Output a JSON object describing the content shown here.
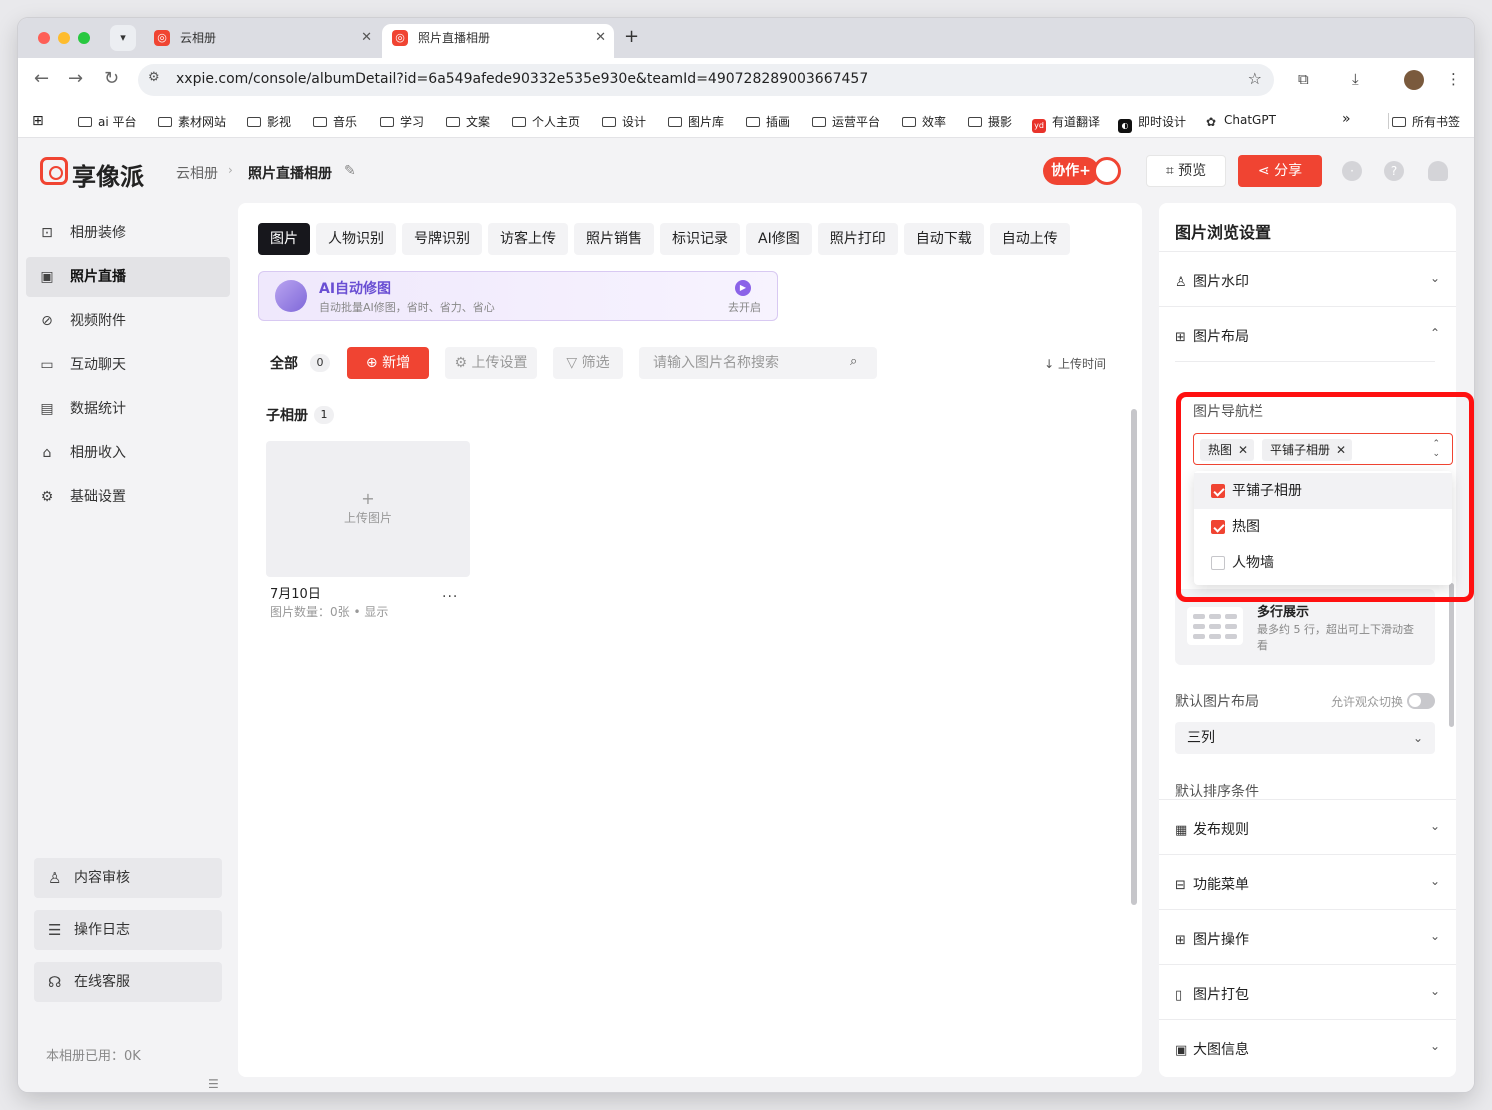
{
  "browser": {
    "tabs": [
      {
        "title": "云相册"
      },
      {
        "title": "照片直播相册"
      }
    ],
    "url": "xxpie.com/console/albumDetail?id=6a549afede90332e535e930e&teamId=490728289003667457",
    "bookmarks": [
      "ai 平台",
      "素材网站",
      "影视",
      "音乐",
      "学习",
      "文案",
      "个人主页",
      "设计",
      "图片库",
      "插画",
      "运营平台",
      "效率",
      "摄影",
      "有道翻译",
      "即时设计",
      "ChatGPT"
    ],
    "more_bookmarks": "»",
    "all_bookmarks": "所有书签"
  },
  "header": {
    "logo_text": "享像派",
    "breadcrumb": [
      "云相册",
      "照片直播相册"
    ],
    "collab_label": "协作+",
    "preview_label": "预览",
    "share_label": "分享"
  },
  "sidebar": {
    "items": [
      {
        "label": "相册装修",
        "icon": "frame-icon"
      },
      {
        "label": "照片直播",
        "icon": "image-icon",
        "active": true
      },
      {
        "label": "视频附件",
        "icon": "paperclip-icon"
      },
      {
        "label": "互动聊天",
        "icon": "chat-icon"
      },
      {
        "label": "数据统计",
        "icon": "chart-icon"
      },
      {
        "label": "相册收入",
        "icon": "store-icon"
      },
      {
        "label": "基础设置",
        "icon": "gear-icon"
      }
    ],
    "bottom_buttons": [
      {
        "label": "内容审核",
        "icon": "audit-icon"
      },
      {
        "label": "操作日志",
        "icon": "log-icon"
      },
      {
        "label": "在线客服",
        "icon": "headset-icon"
      }
    ],
    "usage": "本相册已用：0K"
  },
  "main": {
    "tabs": [
      "图片",
      "人物识别",
      "号牌识别",
      "访客上传",
      "照片销售",
      "标识记录",
      "AI修图",
      "照片打印",
      "自动下载",
      "自动上传"
    ],
    "ai_banner": {
      "title": "AI自动修图",
      "subtitle": "自动批量AI修图，省时、省力、省心",
      "action": "去开启"
    },
    "filter": {
      "all_label": "全部",
      "all_count": "0",
      "add_label": "新增",
      "upload_settings_label": "上传设置",
      "filter_label": "筛选",
      "search_placeholder": "请输入图片名称搜索",
      "sort_label": "上传时间"
    },
    "sub_albums": {
      "title": "子相册",
      "count": "1",
      "upload_label": "上传图片",
      "card_date": "7月10日",
      "card_meta": "图片数量：0张 • 显示"
    }
  },
  "settings": {
    "title": "图片浏览设置",
    "watermark": "图片水印",
    "layout": "图片布局",
    "nav_bar_label": "图片导航栏",
    "nav_tags": [
      "热图",
      "平铺子相册"
    ],
    "nav_options": [
      {
        "label": "平铺子相册",
        "checked": true
      },
      {
        "label": "热图",
        "checked": true
      },
      {
        "label": "人物墙",
        "checked": false
      }
    ],
    "multi_row_title": "多行展示",
    "multi_row_desc": "最多约 5 行，超出可上下滑动查看",
    "default_layout_label": "默认图片布局",
    "allow_switch_label": "允许观众切换",
    "default_layout_value": "三列",
    "default_sort_label": "默认排序条件",
    "sections": [
      "发布规则",
      "功能菜单",
      "图片操作",
      "图片打包",
      "大图信息"
    ]
  },
  "colors": {
    "brand": "#f04432",
    "ai_purple": "#6a4fd3",
    "annotation_red": "#ff1010"
  }
}
